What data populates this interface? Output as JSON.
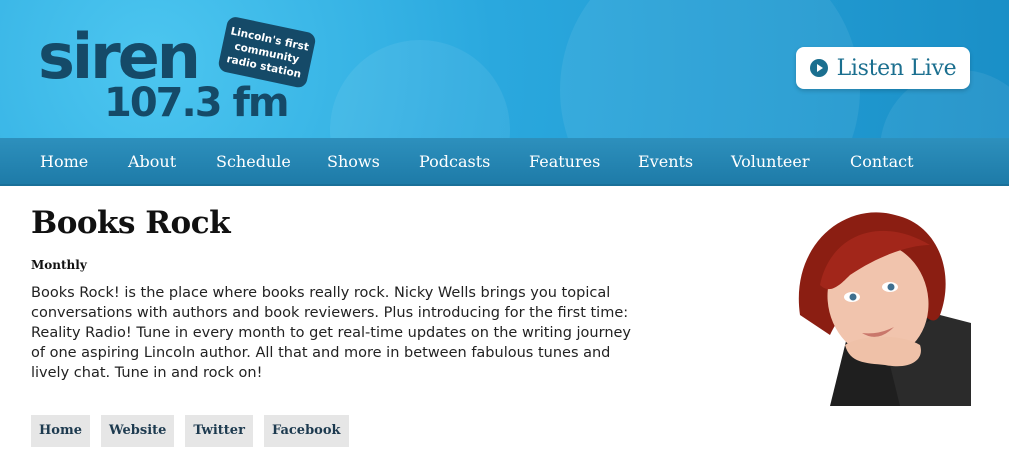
{
  "header": {
    "logo": {
      "word": "siren",
      "frequency": "107.3 fm",
      "tagline": [
        "Lincoln's first",
        "community",
        "radio station"
      ]
    },
    "listen_live": {
      "label": "Listen Live",
      "icon": "play-circle-icon"
    }
  },
  "nav": {
    "items": [
      {
        "label": "Home"
      },
      {
        "label": "About"
      },
      {
        "label": "Schedule"
      },
      {
        "label": "Shows"
      },
      {
        "label": "Podcasts"
      },
      {
        "label": "Features"
      },
      {
        "label": "Events"
      },
      {
        "label": "Volunteer"
      },
      {
        "label": "Contact"
      }
    ]
  },
  "show": {
    "title": "Books Rock",
    "frequency": "Monthly",
    "description": "Books Rock! is the place where books really rock. Nicky Wells brings you topical conversations with authors and book reviewers. Plus introducing for the first time: Reality Radio! Tune in every month to get real-time updates on the writing journey of one aspiring Lincoln author. All that and more in between fabulous tunes and lively chat. Tune in and rock on!",
    "links": [
      {
        "label": "Home"
      },
      {
        "label": "Website"
      },
      {
        "label": "Twitter"
      },
      {
        "label": "Facebook"
      }
    ],
    "photo": {
      "subject": "presenter-photo"
    }
  },
  "colors": {
    "header_blue": "#2aa8de",
    "logo_navy": "#154a68",
    "nav_blue": "#2286b5",
    "accent_teal": "#1b6f8f"
  }
}
